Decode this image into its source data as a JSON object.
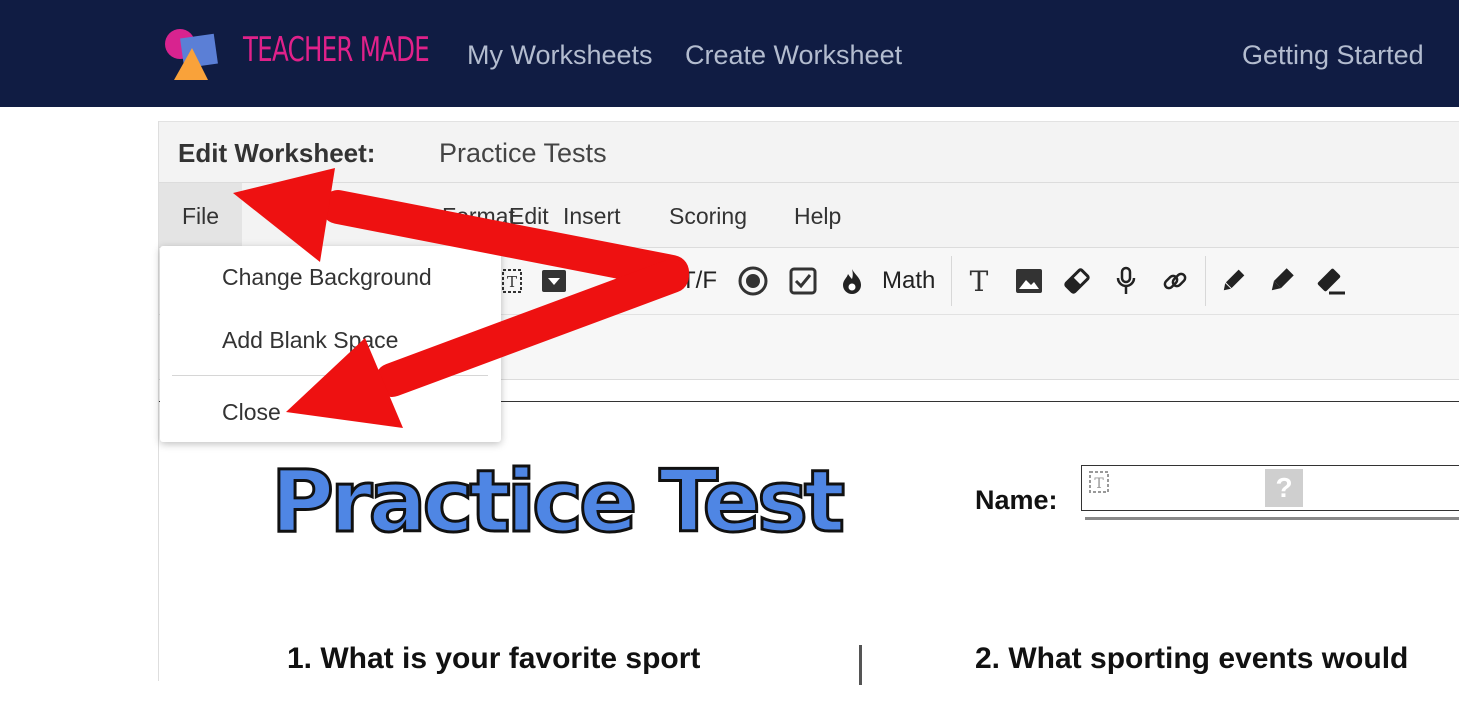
{
  "nav": {
    "brand": "TEACHER MADE",
    "links": [
      "My Worksheets",
      "Create Worksheet"
    ],
    "right_link": "Getting Started"
  },
  "editor": {
    "title_label": "Edit Worksheet:",
    "title_value": "Practice Tests",
    "menu": [
      "File",
      "Edit",
      "Format",
      "Insert",
      "Scoring",
      "Help"
    ],
    "toolbar_text": {
      "tf": "T/F",
      "math": "Math"
    }
  },
  "file_menu": {
    "items": [
      "Change Background",
      "Add Blank Space",
      "Close"
    ]
  },
  "worksheet": {
    "heading": "Practice Test",
    "name_label": "Name:",
    "name_help": "?",
    "q1": "1. What is your favorite sport",
    "q2": "2. What sporting events would"
  },
  "colors": {
    "nav_bg": "#101c43",
    "brand": "#e0218a",
    "heading": "#4f86e4",
    "annotation_arrow": "#ee1111"
  },
  "icons": [
    "text-box-icon",
    "dropdown-icon",
    "radio-icon",
    "checkbox-icon",
    "fire-icon",
    "text-icon",
    "image-icon",
    "eraser-icon",
    "audio-icon",
    "link-icon",
    "pencil-icon",
    "marker-icon",
    "highlighter-eraser-icon"
  ]
}
